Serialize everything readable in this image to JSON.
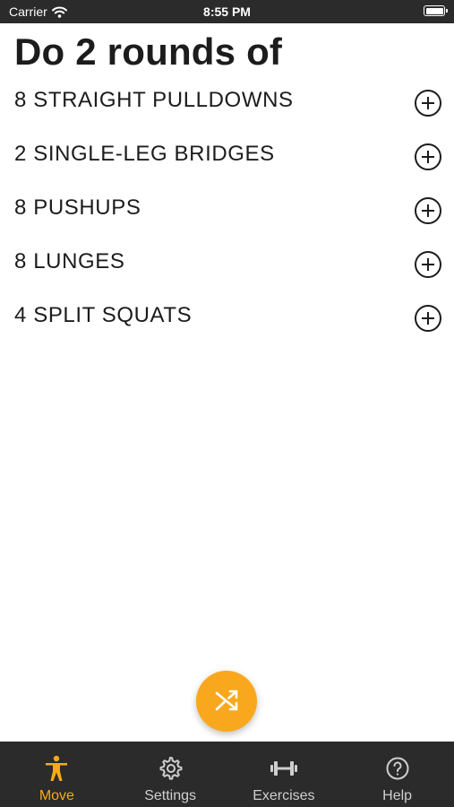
{
  "status_bar": {
    "carrier": "Carrier",
    "time": "8:55 PM"
  },
  "main": {
    "title": "Do 2 rounds of",
    "exercises": [
      {
        "label": "8 STRAIGHT PULLDOWNS"
      },
      {
        "label": "2 SINGLE-LEG BRIDGES"
      },
      {
        "label": "8 PUSHUPS"
      },
      {
        "label": "8 LUNGES"
      },
      {
        "label": "4 SPLIT SQUATS"
      }
    ]
  },
  "fab": {
    "icon": "shuffle-icon"
  },
  "tab_bar": {
    "tabs": [
      {
        "label": "Move",
        "icon": "person-icon",
        "active": true
      },
      {
        "label": "Settings",
        "icon": "gear-icon",
        "active": false
      },
      {
        "label": "Exercises",
        "icon": "dumbbell-icon",
        "active": false
      },
      {
        "label": "Help",
        "icon": "question-icon",
        "active": false
      }
    ]
  },
  "colors": {
    "accent": "#f9a81d",
    "bar_background": "#2b2b2b",
    "text": "#1c1c1c",
    "inactive_tab": "#cfcfcf"
  }
}
